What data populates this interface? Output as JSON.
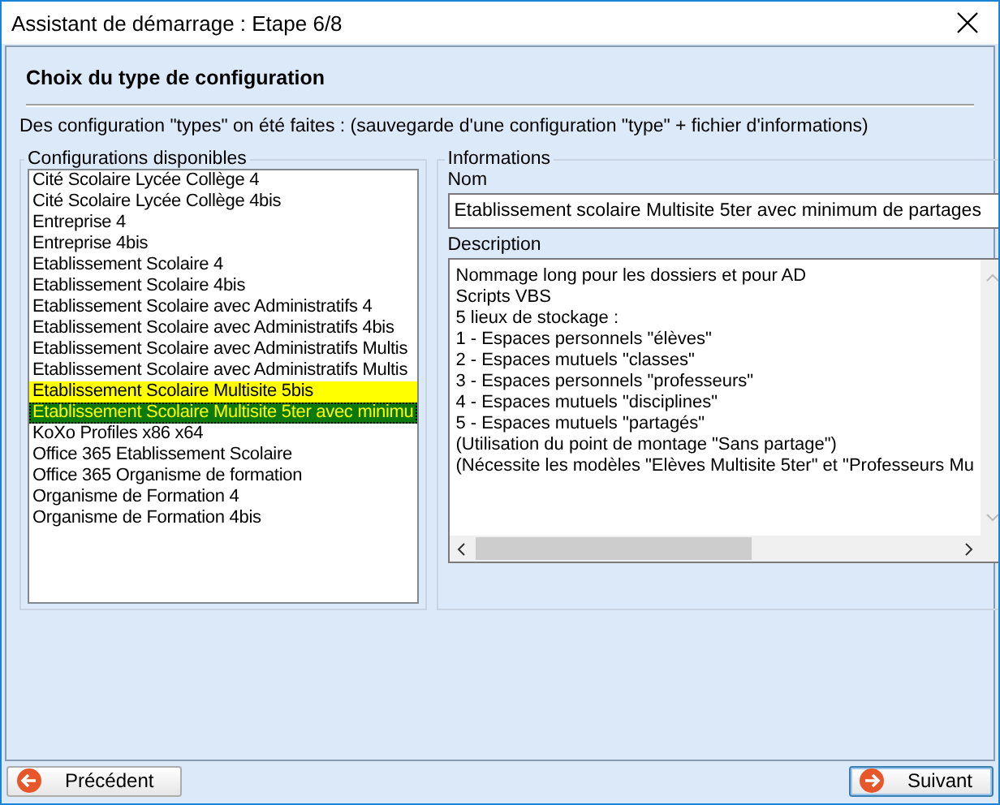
{
  "window": {
    "title": "Assistant de démarrage : Etape 6/8"
  },
  "heading": "Choix du type de configuration",
  "intro": "Des configuration \"types\" on été faites : (sauvegarde d'une configuration \"type\" + fichier d'informations)",
  "configurations": {
    "label": "Configurations disponibles",
    "items": [
      {
        "label": "Cité Scolaire Lycée Collège 4",
        "selected": false,
        "highlighted": false
      },
      {
        "label": "Cité Scolaire Lycée Collège 4bis",
        "selected": false,
        "highlighted": false
      },
      {
        "label": "Entreprise 4",
        "selected": false,
        "highlighted": false
      },
      {
        "label": "Entreprise 4bis",
        "selected": false,
        "highlighted": false
      },
      {
        "label": "Etablissement Scolaire 4",
        "selected": false,
        "highlighted": false
      },
      {
        "label": "Etablissement Scolaire 4bis",
        "selected": false,
        "highlighted": false
      },
      {
        "label": "Etablissement Scolaire avec Administratifs 4",
        "selected": false,
        "highlighted": false
      },
      {
        "label": "Etablissement Scolaire avec Administratifs 4bis",
        "selected": false,
        "highlighted": false
      },
      {
        "label": "Etablissement Scolaire avec Administratifs Multis",
        "selected": false,
        "highlighted": false
      },
      {
        "label": "Etablissement Scolaire avec Administratifs Multis",
        "selected": false,
        "highlighted": false
      },
      {
        "label": "Etablissement Scolaire Multisite 5bis",
        "selected": false,
        "highlighted": true
      },
      {
        "label": "Etablissement Scolaire Multisite 5ter avec minimu",
        "selected": true,
        "highlighted": true
      },
      {
        "label": "KoXo Profiles x86 x64",
        "selected": false,
        "highlighted": false
      },
      {
        "label": "Office 365 Etablissement Scolaire",
        "selected": false,
        "highlighted": false
      },
      {
        "label": "Office 365 Organisme de formation",
        "selected": false,
        "highlighted": false
      },
      {
        "label": "Organisme de Formation 4",
        "selected": false,
        "highlighted": false
      },
      {
        "label": "Organisme de Formation 4bis",
        "selected": false,
        "highlighted": false
      }
    ]
  },
  "informations": {
    "label": "Informations",
    "name_label": "Nom",
    "name_value": "Etablissement scolaire Multisite 5ter avec minimum de partages",
    "description_label": "Description",
    "description_lines": [
      "Nommage long pour les dossiers et pour AD",
      "Scripts VBS",
      "5 lieux de stockage :",
      "1 - Espaces personnels \"élèves\"",
      "2 - Espaces mutuels \"classes\"",
      "3 - Espaces personnels \"professeurs\"",
      "4 - Espaces mutuels \"disciplines\"",
      "5 - Espaces mutuels \"partagés\"",
      "(Utilisation du point de montage \"Sans partage\")",
      "(Nécessite les modèles \"Elèves Multisite 5ter\" et \"Professeurs Mu"
    ]
  },
  "buttons": {
    "previous": "Précédent",
    "next": "Suivant"
  }
}
